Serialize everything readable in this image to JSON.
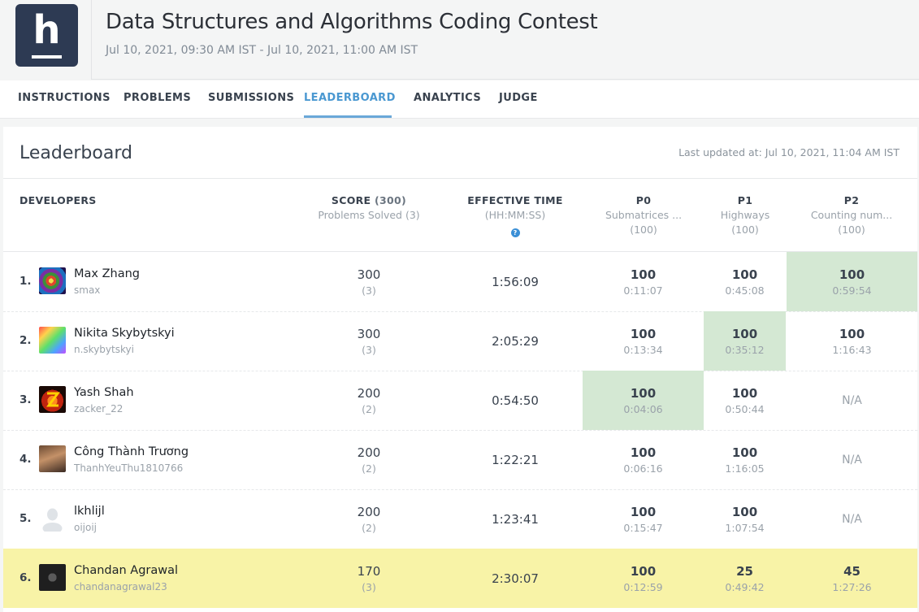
{
  "contest": {
    "title": "Data Structures and Algorithms Coding Contest",
    "dates": "Jul 10, 2021, 09:30 AM IST - Jul 10, 2021, 11:00 AM IST",
    "logo_letter": "h"
  },
  "tabs": [
    {
      "label": "INSTRUCTIONS",
      "active": false
    },
    {
      "label": "PROBLEMS",
      "active": false
    },
    {
      "label": "SUBMISSIONS",
      "active": false
    },
    {
      "label": "LEADERBOARD",
      "active": true
    },
    {
      "label": "ANALYTICS",
      "active": false
    },
    {
      "label": "JUDGE",
      "active": false
    }
  ],
  "leaderboard": {
    "title": "Leaderboard",
    "last_updated": "Last updated at: Jul 10, 2021, 11:04 AM IST",
    "headers": {
      "developers": "DEVELOPERS",
      "score": "SCORE",
      "score_total": "(300)",
      "score_sub": "Problems Solved (3)",
      "effective_time": "EFFECTIVE TIME",
      "effective_time_sub": "(HH:MM:SS)",
      "help_glyph": "?",
      "problems": [
        {
          "code": "P0",
          "name": "Submatrices ...",
          "points": "(100)"
        },
        {
          "code": "P1",
          "name": "Highways",
          "points": "(100)"
        },
        {
          "code": "P2",
          "name": "Counting num...",
          "points": "(100)"
        }
      ]
    },
    "rows": [
      {
        "rank": "1.",
        "name": "Max Zhang",
        "username": "smax",
        "score": "300",
        "solved": "(3)",
        "time": "1:56:09",
        "me": false,
        "avatar": "spiral-avatar",
        "problems": [
          {
            "score": "100",
            "time": "0:11:07",
            "first": false
          },
          {
            "score": "100",
            "time": "0:45:08",
            "first": false
          },
          {
            "score": "100",
            "time": "0:59:54",
            "first": true
          }
        ]
      },
      {
        "rank": "2.",
        "name": "Nikita Skybytskyi",
        "username": "n.skybytskyi",
        "score": "300",
        "solved": "(3)",
        "time": "2:05:29",
        "me": false,
        "avatar": "rainbow-face-avatar",
        "problems": [
          {
            "score": "100",
            "time": "0:13:34",
            "first": false
          },
          {
            "score": "100",
            "time": "0:35:12",
            "first": true
          },
          {
            "score": "100",
            "time": "1:16:43",
            "first": false
          }
        ]
      },
      {
        "rank": "3.",
        "name": "Yash Shah",
        "username": "zacker_22",
        "score": "200",
        "solved": "(2)",
        "time": "0:54:50",
        "me": false,
        "avatar": "fire-z-avatar",
        "problems": [
          {
            "score": "100",
            "time": "0:04:06",
            "first": true
          },
          {
            "score": "100",
            "time": "0:50:44",
            "first": false
          },
          {
            "score": "N/A",
            "time": "",
            "first": false
          }
        ]
      },
      {
        "rank": "4.",
        "name": "Công Thành Trương",
        "username": "ThanhYeuThu1810766",
        "score": "200",
        "solved": "(2)",
        "time": "1:22:21",
        "me": false,
        "avatar": "photo-avatar",
        "problems": [
          {
            "score": "100",
            "time": "0:06:16",
            "first": false
          },
          {
            "score": "100",
            "time": "1:16:05",
            "first": false
          },
          {
            "score": "N/A",
            "time": "",
            "first": false
          }
        ]
      },
      {
        "rank": "5.",
        "name": "lkhlijl",
        "username": "oijoij",
        "score": "200",
        "solved": "(2)",
        "time": "1:23:41",
        "me": false,
        "avatar": "default-avatar",
        "problems": [
          {
            "score": "100",
            "time": "0:15:47",
            "first": false
          },
          {
            "score": "100",
            "time": "1:07:54",
            "first": false
          },
          {
            "score": "N/A",
            "time": "",
            "first": false
          }
        ]
      },
      {
        "rank": "6.",
        "name": "Chandan Agrawal",
        "username": "chandanagrawal23",
        "score": "170",
        "solved": "(3)",
        "time": "2:30:07",
        "me": true,
        "avatar": "dark-logo-avatar",
        "problems": [
          {
            "score": "100",
            "time": "0:12:59",
            "first": false
          },
          {
            "score": "25",
            "time": "0:49:42",
            "first": false
          },
          {
            "score": "45",
            "time": "1:27:26",
            "first": false
          }
        ]
      }
    ]
  },
  "colors": {
    "accent": "#4a98d1",
    "first_solve": "#d4e8d3",
    "current_user": "#f8f3a7",
    "logo_bg": "#2d3a53"
  }
}
